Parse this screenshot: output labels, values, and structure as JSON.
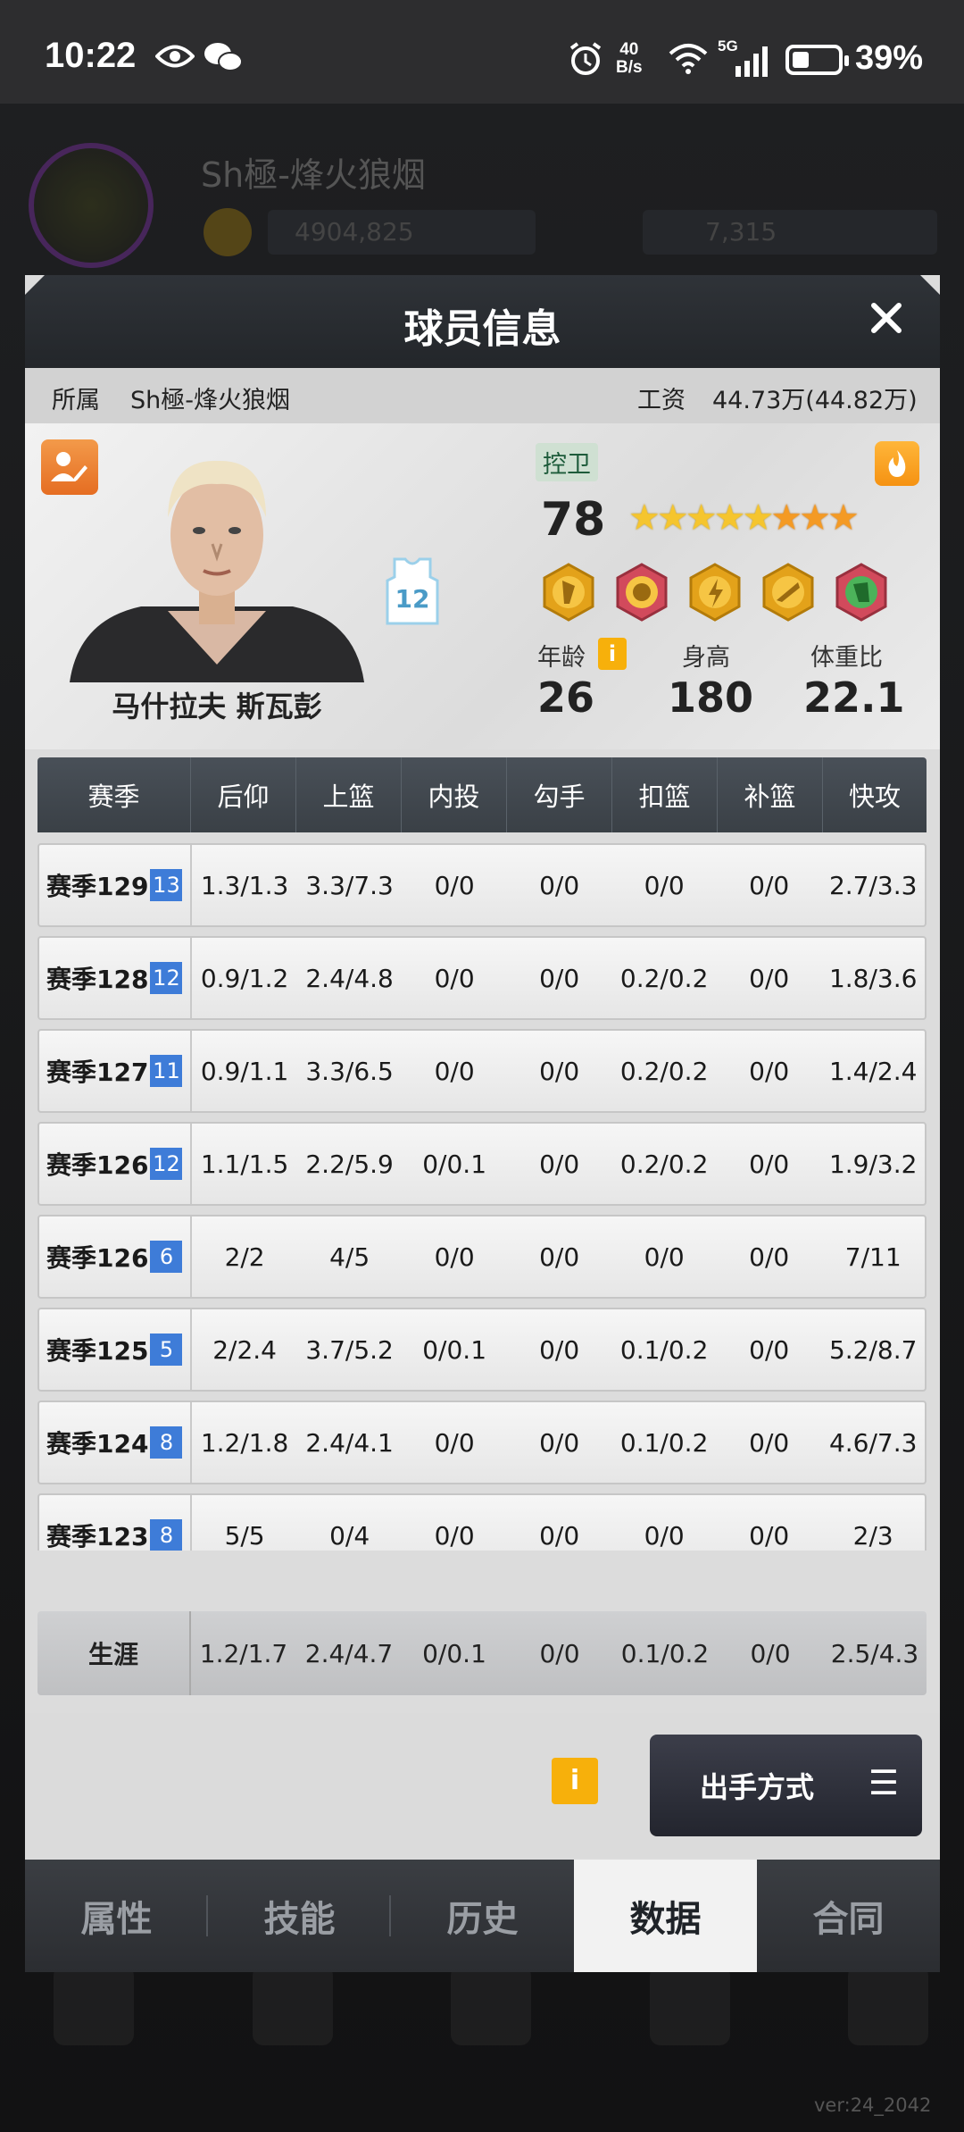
{
  "status_bar": {
    "time": "10:22",
    "net_speed_top": "40",
    "net_speed_bottom": "B/s",
    "network": "5G",
    "battery": "39%"
  },
  "background": {
    "name": "Sh極-烽火狼烟",
    "coins": "4904,825",
    "gems": "7,315",
    "version": "ver:24_2042"
  },
  "modal": {
    "title": "球员信息",
    "info": {
      "team_label": "所属",
      "team": "Sh極-烽火狼烟",
      "salary_label": "工资",
      "salary": "44.73万(44.82万)"
    },
    "player": {
      "name": "马什拉夫 斯瓦彭",
      "jersey": "12",
      "position": "控卫",
      "overall": "78",
      "stars_gold": 5,
      "stars_orange": 3,
      "skills": [
        "skill-icon-1",
        "skill-icon-2",
        "skill-icon-3",
        "skill-icon-4",
        "skill-icon-5"
      ],
      "stats": [
        {
          "label": "年龄",
          "value": "26"
        },
        {
          "label": "身高",
          "value": "180"
        },
        {
          "label": "体重比",
          "value": "22.1"
        }
      ]
    },
    "table": {
      "headers": [
        "赛季",
        "后仰",
        "上篮",
        "内投",
        "勾手",
        "扣篮",
        "补篮",
        "快攻"
      ],
      "rows": [
        {
          "season": "赛季129",
          "badge": "13",
          "cells": [
            "1.3/1.3",
            "3.3/7.3",
            "0/0",
            "0/0",
            "0/0",
            "0/0",
            "2.7/3.3"
          ]
        },
        {
          "season": "赛季128",
          "badge": "12",
          "cells": [
            "0.9/1.2",
            "2.4/4.8",
            "0/0",
            "0/0",
            "0.2/0.2",
            "0/0",
            "1.8/3.6"
          ]
        },
        {
          "season": "赛季127",
          "badge": "11",
          "cells": [
            "0.9/1.1",
            "3.3/6.5",
            "0/0",
            "0/0",
            "0.2/0.2",
            "0/0",
            "1.4/2.4"
          ]
        },
        {
          "season": "赛季126",
          "badge": "12",
          "cells": [
            "1.1/1.5",
            "2.2/5.9",
            "0/0.1",
            "0/0",
            "0.2/0.2",
            "0/0",
            "1.9/3.2"
          ]
        },
        {
          "season": "赛季126",
          "badge": "6",
          "cells": [
            "2/2",
            "4/5",
            "0/0",
            "0/0",
            "0/0",
            "0/0",
            "7/11"
          ]
        },
        {
          "season": "赛季125",
          "badge": "5",
          "cells": [
            "2/2.4",
            "3.7/5.2",
            "0/0.1",
            "0/0",
            "0.1/0.2",
            "0/0",
            "5.2/8.7"
          ]
        },
        {
          "season": "赛季124",
          "badge": "8",
          "cells": [
            "1.2/1.8",
            "2.4/4.1",
            "0/0",
            "0/0",
            "0.1/0.2",
            "0/0",
            "4.6/7.3"
          ]
        },
        {
          "season": "赛季123",
          "badge": "8",
          "cells": [
            "5/5",
            "0/4",
            "0/0",
            "0/0",
            "0/0",
            "0/0",
            "2/3"
          ]
        }
      ],
      "career": {
        "label": "生涯",
        "cells": [
          "1.2/1.7",
          "2.4/4.7",
          "0/0.1",
          "0/0",
          "0.1/0.2",
          "0/0",
          "2.5/4.3"
        ]
      }
    },
    "shoot_button": "出手方式",
    "tabs": [
      "属性",
      "技能",
      "历史",
      "数据",
      "合同"
    ],
    "active_tab": "数据"
  }
}
